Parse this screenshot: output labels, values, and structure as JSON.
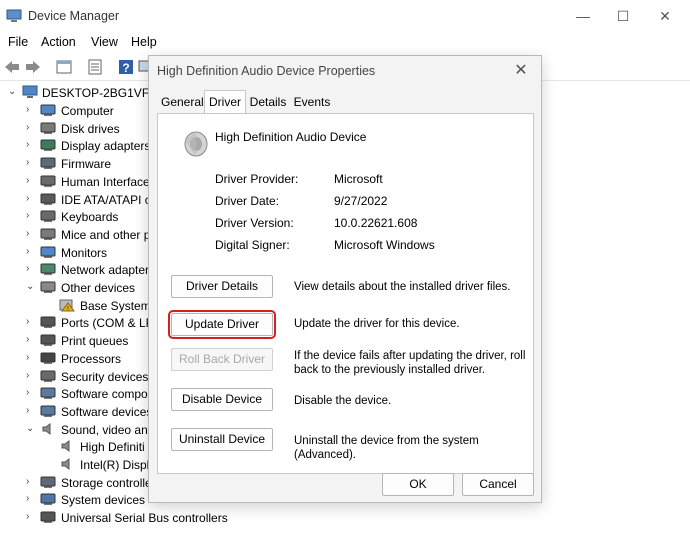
{
  "window": {
    "title": "Device Manager",
    "minimize": "—",
    "maximize": "☐",
    "close": "✕"
  },
  "menu": [
    "File",
    "Action",
    "View",
    "Help"
  ],
  "tree": {
    "root": "DESKTOP-2BG1VF6",
    "items": [
      {
        "label": "Computer",
        "icon": "computer-icon",
        "indent": 1
      },
      {
        "label": "Disk drives",
        "icon": "disk-drive-icon",
        "indent": 1
      },
      {
        "label": "Display adapters",
        "icon": "display-adapter-icon",
        "indent": 1
      },
      {
        "label": "Firmware",
        "icon": "firmware-icon",
        "indent": 1
      },
      {
        "label": "Human Interface",
        "icon": "hid-icon",
        "indent": 1
      },
      {
        "label": "IDE ATA/ATAPI cc",
        "icon": "ide-icon",
        "indent": 1
      },
      {
        "label": "Keyboards",
        "icon": "keyboard-icon",
        "indent": 1
      },
      {
        "label": "Mice and other p",
        "icon": "mouse-icon",
        "indent": 1
      },
      {
        "label": "Monitors",
        "icon": "monitor-icon",
        "indent": 1
      },
      {
        "label": "Network adapter",
        "icon": "network-icon",
        "indent": 1
      },
      {
        "label": "Other devices",
        "icon": "other-devices-icon",
        "indent": 1,
        "expanded": true
      },
      {
        "label": "Base System",
        "icon": "warning-icon",
        "indent": 2
      },
      {
        "label": "Ports (COM & LP",
        "icon": "ports-icon",
        "indent": 1
      },
      {
        "label": "Print queues",
        "icon": "printer-icon",
        "indent": 1
      },
      {
        "label": "Processors",
        "icon": "processor-icon",
        "indent": 1
      },
      {
        "label": "Security devices",
        "icon": "security-icon",
        "indent": 1
      },
      {
        "label": "Software compo",
        "icon": "software-icon",
        "indent": 1
      },
      {
        "label": "Software devices",
        "icon": "software-icon",
        "indent": 1
      },
      {
        "label": "Sound, video and",
        "icon": "speaker-icon",
        "indent": 1,
        "expanded": true
      },
      {
        "label": "High Definiti",
        "icon": "speaker-icon",
        "indent": 2
      },
      {
        "label": "Intel(R) Displ",
        "icon": "speaker-icon",
        "indent": 2
      },
      {
        "label": "Storage controlle",
        "icon": "storage-icon",
        "indent": 1
      },
      {
        "label": "System devices",
        "icon": "system-icon",
        "indent": 1
      },
      {
        "label": "Universal Serial Bus controllers",
        "icon": "usb-icon",
        "indent": 1
      }
    ]
  },
  "dialog": {
    "title": "High Definition Audio Device Properties",
    "close": "✕",
    "tabs": [
      "General",
      "Driver",
      "Details",
      "Events"
    ],
    "active_tab": "Driver",
    "device_name": "High Definition Audio Device",
    "props": [
      {
        "key": "Driver Provider:",
        "value": "Microsoft"
      },
      {
        "key": "Driver Date:",
        "value": "9/27/2022"
      },
      {
        "key": "Driver Version:",
        "value": "10.0.22621.608"
      },
      {
        "key": "Digital Signer:",
        "value": "Microsoft Windows"
      }
    ],
    "actions": [
      {
        "label": "Driver Details",
        "desc": "View details about the installed driver files.",
        "state": "enabled"
      },
      {
        "label": "Update Driver",
        "desc": "Update the driver for this device.",
        "state": "highlighted"
      },
      {
        "label": "Roll Back Driver",
        "desc": "If the device fails after updating the driver, roll back to the previously installed driver.",
        "state": "disabled"
      },
      {
        "label": "Disable Device",
        "desc": "Disable the device.",
        "state": "enabled"
      },
      {
        "label": "Uninstall Device",
        "desc": "Uninstall the device from the system (Advanced).",
        "state": "enabled"
      }
    ],
    "ok": "OK",
    "cancel": "Cancel"
  },
  "colors": {
    "highlight": "#d42020",
    "tree_icon": "#3a6ea5"
  }
}
